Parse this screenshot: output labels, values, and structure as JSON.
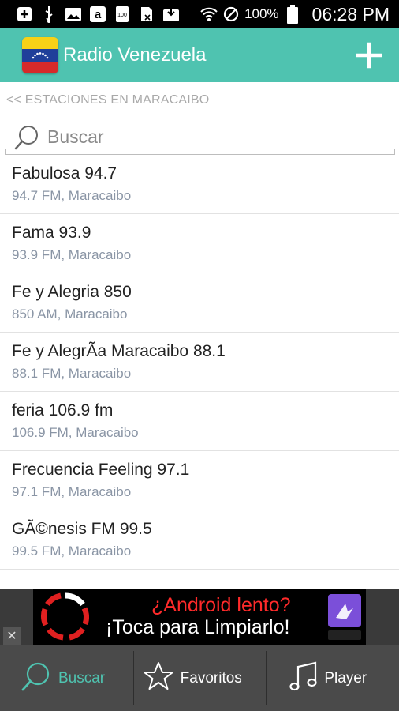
{
  "status_bar": {
    "battery_percent": "100%",
    "time": "06:28 PM",
    "icons": [
      "add-box-icon",
      "usb-icon",
      "image-icon",
      "amazon-icon",
      "notification-100-icon",
      "sim-icon",
      "download-icon",
      "wifi-icon",
      "blocked-icon",
      "battery-icon"
    ]
  },
  "app_bar": {
    "title": "Radio Venezuela",
    "flag_icon": "venezuela-flag-icon",
    "add_icon": "plus-icon"
  },
  "breadcrumb": "<< ESTACIONES EN MARACAIBO",
  "search": {
    "placeholder": "Buscar",
    "value": ""
  },
  "stations": [
    {
      "name": "Fabulosa 94.7",
      "detail": "94.7 FM, Maracaibo"
    },
    {
      "name": "Fama 93.9",
      "detail": "93.9 FM, Maracaibo"
    },
    {
      "name": "Fe y Alegria 850",
      "detail": "850 AM, Maracaibo"
    },
    {
      "name": "Fe y AlegrÃa Maracaibo 88.1",
      "detail": "88.1 FM, Maracaibo"
    },
    {
      "name": "feria 106.9 fm",
      "detail": "106.9 FM, Maracaibo"
    },
    {
      "name": "Frecuencia Feeling 97.1",
      "detail": "97.1 FM, Maracaibo"
    },
    {
      "name": "GÃ©nesis FM 99.5",
      "detail": "99.5 FM, Maracaibo"
    }
  ],
  "ad": {
    "line1": "¿Android lento?",
    "line2": "¡Toca para Limpiarlo!",
    "close": "✕"
  },
  "bottom_nav": {
    "tabs": [
      {
        "label": "Buscar",
        "icon": "search-icon",
        "active": true
      },
      {
        "label": "Favoritos",
        "icon": "star-icon",
        "active": false
      },
      {
        "label": "Player",
        "icon": "music-note-icon",
        "active": false
      }
    ]
  },
  "colors": {
    "accent": "#4fc3b0",
    "active_tab": "#4fc3b0",
    "subtitle": "#8a95a5"
  }
}
